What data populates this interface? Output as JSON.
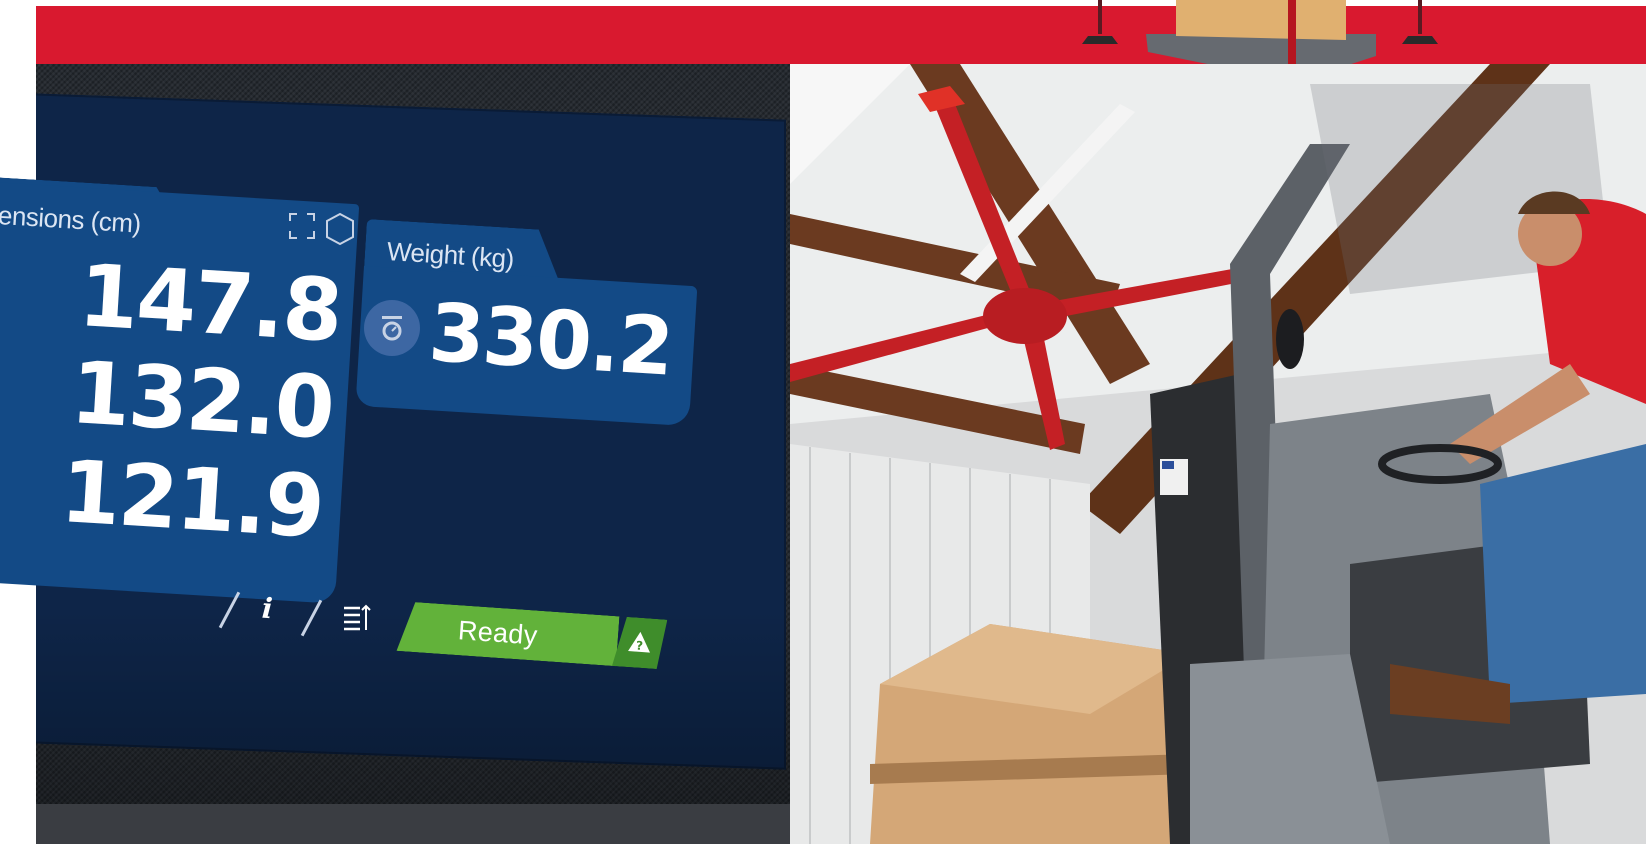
{
  "banner": {
    "color": "#d9192f"
  },
  "terminal": {
    "dimensions": {
      "title": "ensions (cm)",
      "values": [
        "147.8",
        "132.0",
        "121.9"
      ],
      "icons": [
        "frame-corners-icon",
        "hexagon-icon"
      ]
    },
    "weight": {
      "title": "Weight (kg)",
      "value": "330.2",
      "icon": "scale-icon"
    },
    "toolbar": {
      "icons": [
        "info-icon",
        "list-sort-icon"
      ]
    },
    "status": {
      "label": "Ready",
      "icon": "warning-icon",
      "color": "#62b23a"
    },
    "colors": {
      "screen": "#0e2548",
      "card": "#134a86"
    }
  },
  "photo": {
    "description_icon": "forklift-warehouse-photo"
  }
}
